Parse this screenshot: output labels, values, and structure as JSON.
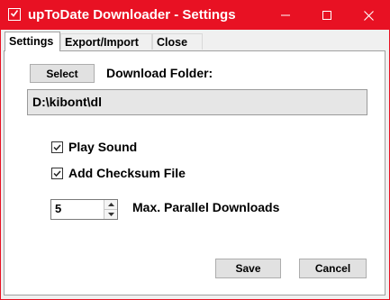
{
  "window": {
    "title": "upToDate Downloader - Settings",
    "accent_color": "#e81123",
    "icons": {
      "app": "checkbox-app-icon",
      "minimize": "minimize-icon",
      "maximize": "maximize-icon",
      "close": "close-icon"
    }
  },
  "tabs": [
    {
      "label": "Settings",
      "active": true
    },
    {
      "label": "Export/Import",
      "active": false
    },
    {
      "label": "Close",
      "active": false
    }
  ],
  "settings": {
    "select_button": "Select",
    "download_folder_label": "Download Folder:",
    "download_folder_value": "D:\\kibont\\dl",
    "play_sound": {
      "label": "Play Sound",
      "checked": true
    },
    "add_checksum": {
      "label": "Add Checksum File",
      "checked": true
    },
    "parallel_downloads": {
      "value": "5",
      "label": "Max. Parallel Downloads"
    },
    "save_button": "Save",
    "cancel_button": "Cancel"
  }
}
